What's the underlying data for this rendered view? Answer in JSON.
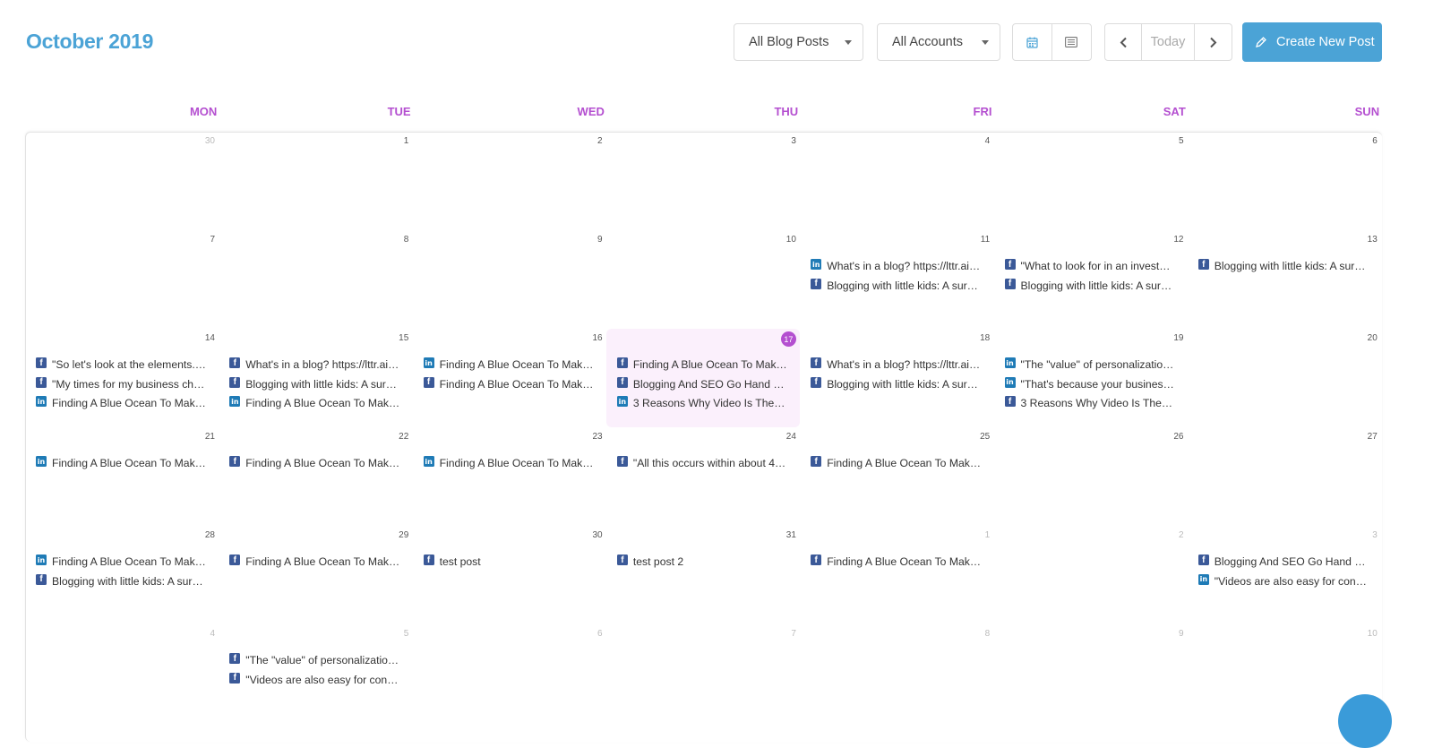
{
  "header": {
    "title": "October 2019",
    "filter_posts": "All Blog Posts",
    "filter_accounts": "All Accounts",
    "today_label": "Today",
    "create_label": "Create New Post"
  },
  "weekdays": [
    "MON",
    "TUE",
    "WED",
    "THU",
    "FRI",
    "SAT",
    "SUN"
  ],
  "weeks": [
    [
      {
        "day": "30",
        "out": true,
        "posts": []
      },
      {
        "day": "1",
        "posts": []
      },
      {
        "day": "2",
        "posts": []
      },
      {
        "day": "3",
        "posts": []
      },
      {
        "day": "4",
        "posts": []
      },
      {
        "day": "5",
        "posts": []
      },
      {
        "day": "6",
        "posts": []
      }
    ],
    [
      {
        "day": "7",
        "posts": []
      },
      {
        "day": "8",
        "posts": []
      },
      {
        "day": "9",
        "posts": []
      },
      {
        "day": "10",
        "posts": []
      },
      {
        "day": "11",
        "posts": [
          {
            "net": "li",
            "text": "What's in a blog? https://lttr.ai…"
          },
          {
            "net": "fb",
            "text": "Blogging with little kids: A sur…"
          }
        ]
      },
      {
        "day": "12",
        "posts": [
          {
            "net": "fb",
            "text": "\"What to look for in an invest…"
          },
          {
            "net": "fb",
            "text": "Blogging with little kids: A sur…"
          }
        ]
      },
      {
        "day": "13",
        "posts": [
          {
            "net": "fb",
            "text": "Blogging with little kids: A sur…"
          }
        ]
      }
    ],
    [
      {
        "day": "14",
        "posts": [
          {
            "net": "fb",
            "text": "\"So let's look at the elements.…"
          },
          {
            "net": "fb",
            "text": "\"My times for my business cha…"
          },
          {
            "net": "li",
            "text": "Finding A Blue Ocean To Mak…"
          }
        ]
      },
      {
        "day": "15",
        "posts": [
          {
            "net": "fb",
            "text": "What's in a blog? https://lttr.ai…"
          },
          {
            "net": "fb",
            "text": "Blogging with little kids: A sur…"
          },
          {
            "net": "li",
            "text": "Finding A Blue Ocean To Mak…"
          }
        ]
      },
      {
        "day": "16",
        "posts": [
          {
            "net": "li",
            "text": "Finding A Blue Ocean To Mak…"
          },
          {
            "net": "fb",
            "text": "Finding A Blue Ocean To Mak…"
          }
        ]
      },
      {
        "day": "17",
        "today": true,
        "posts": [
          {
            "net": "fb",
            "text": "Finding A Blue Ocean To Mak…"
          },
          {
            "net": "fb",
            "text": "Blogging And SEO Go Hand I…"
          },
          {
            "net": "li",
            "text": "3 Reasons Why Video Is The F…"
          }
        ]
      },
      {
        "day": "18",
        "posts": [
          {
            "net": "fb",
            "text": "What's in a blog? https://lttr.ai…"
          },
          {
            "net": "fb",
            "text": "Blogging with little kids: A sur…"
          }
        ]
      },
      {
        "day": "19",
        "posts": [
          {
            "net": "li",
            "text": "\"The \"value\" of personalizatio…"
          },
          {
            "net": "li",
            "text": "\"That's because your business…"
          },
          {
            "net": "fb",
            "text": "3 Reasons Why Video Is The F…"
          }
        ]
      },
      {
        "day": "20",
        "posts": []
      }
    ],
    [
      {
        "day": "21",
        "posts": [
          {
            "net": "li",
            "text": "Finding A Blue Ocean To Mak…"
          }
        ]
      },
      {
        "day": "22",
        "posts": [
          {
            "net": "fb",
            "text": "Finding A Blue Ocean To Mak…"
          }
        ]
      },
      {
        "day": "23",
        "posts": [
          {
            "net": "li",
            "text": "Finding A Blue Ocean To Mak…"
          }
        ]
      },
      {
        "day": "24",
        "posts": [
          {
            "net": "fb",
            "text": "\"All this occurs within about 4…"
          }
        ]
      },
      {
        "day": "25",
        "posts": [
          {
            "net": "fb",
            "text": "Finding A Blue Ocean To Mak…"
          }
        ]
      },
      {
        "day": "26",
        "posts": []
      },
      {
        "day": "27",
        "posts": []
      }
    ],
    [
      {
        "day": "28",
        "posts": [
          {
            "net": "li",
            "text": "Finding A Blue Ocean To Mak…"
          },
          {
            "net": "fb",
            "text": "Blogging with little kids: A sur…"
          }
        ]
      },
      {
        "day": "29",
        "posts": [
          {
            "net": "fb",
            "text": "Finding A Blue Ocean To Mak…"
          }
        ]
      },
      {
        "day": "30",
        "posts": [
          {
            "net": "fb",
            "text": "test post"
          }
        ]
      },
      {
        "day": "31",
        "posts": [
          {
            "net": "fb",
            "text": "test post 2"
          }
        ]
      },
      {
        "day": "1",
        "out": true,
        "posts": [
          {
            "net": "fb",
            "text": "Finding A Blue Ocean To Mak…"
          }
        ]
      },
      {
        "day": "2",
        "out": true,
        "posts": []
      },
      {
        "day": "3",
        "out": true,
        "posts": [
          {
            "net": "fb",
            "text": "Blogging And SEO Go Hand I…"
          },
          {
            "net": "li",
            "text": "\"Videos are also easy for cons…"
          }
        ]
      }
    ],
    [
      {
        "day": "4",
        "out": true,
        "posts": []
      },
      {
        "day": "5",
        "out": true,
        "posts": [
          {
            "net": "fb",
            "text": "\"The \"value\" of personalizatio…"
          },
          {
            "net": "fb",
            "text": "\"Videos are also easy for cons…"
          }
        ]
      },
      {
        "day": "6",
        "out": true,
        "posts": []
      },
      {
        "day": "7",
        "out": true,
        "posts": []
      },
      {
        "day": "8",
        "out": true,
        "posts": []
      },
      {
        "day": "9",
        "out": true,
        "posts": []
      },
      {
        "day": "10",
        "out": true,
        "posts": []
      }
    ]
  ],
  "icons": {
    "facebook": "facebook-icon",
    "linkedin": "linkedin-icon",
    "calendar": "calendar-view-icon",
    "list": "list-view-icon",
    "prev": "chevron-left-icon",
    "next": "chevron-right-icon",
    "pencil": "pencil-icon"
  },
  "colors": {
    "accent": "#4ba3d6",
    "weekday": "#b44fd0",
    "today_bg": "#fbf0fc",
    "facebook": "#3b5998",
    "linkedin": "#1f7bb6"
  }
}
